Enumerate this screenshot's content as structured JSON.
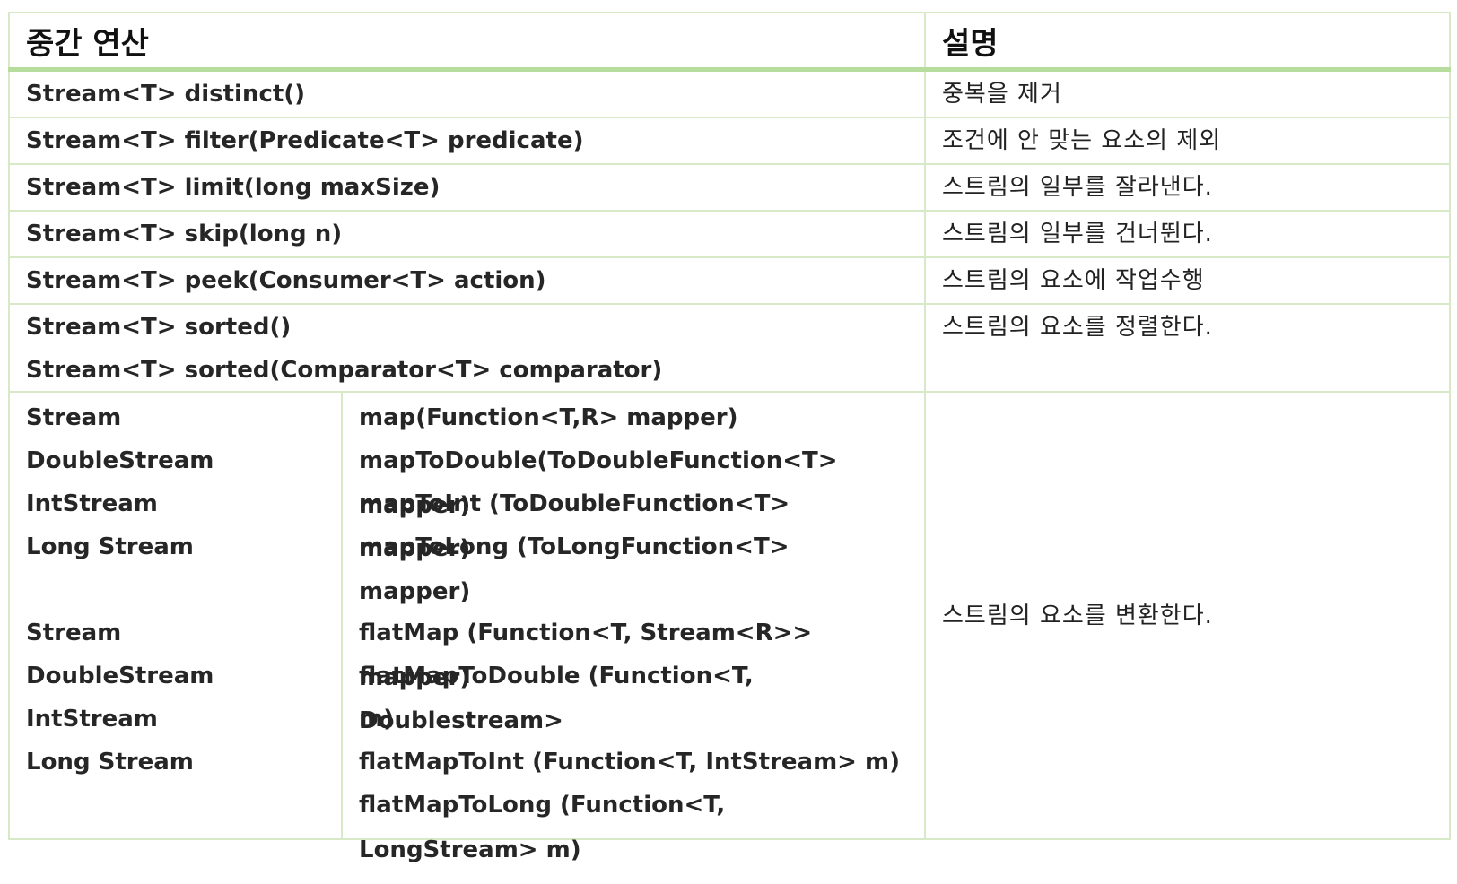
{
  "header": {
    "op": "중간 연산",
    "desc": "설명"
  },
  "rows": [
    {
      "op": "Stream<T> distinct()",
      "desc": "중복을 제거"
    },
    {
      "op": "Stream<T> filter(Predicate<T> predicate)",
      "desc": "조건에 안 맞는 요소의 제외"
    },
    {
      "op": "Stream<T> limit(long maxSize)",
      "desc": "스트림의 일부를 잘라낸다."
    },
    {
      "op": "Stream<T> skip(long n)",
      "desc": "스트림의 일부를 건너뛴다."
    },
    {
      "op": "Stream<T> peek(Consumer<T> action)",
      "desc": "스트림의 요소에 작업수행"
    }
  ],
  "sorted": {
    "ops": [
      "Stream<T> sorted()",
      "Stream<T> sorted(Comparator<T> comparator)"
    ],
    "desc": "스트림의 요소를 정렬한다."
  },
  "map": {
    "types": [
      "Stream",
      "DoubleStream",
      "IntStream",
      "Long Stream",
      "Stream",
      "DoubleStream",
      "IntStream",
      "Long Stream"
    ],
    "methods": [
      "map(Function<T,R> mapper)",
      "mapToDouble(ToDoubleFunction<T> mapper)",
      "mapToInt (ToDoubleFunction<T> mapper)",
      "mapToLong (ToLongFunction<T> mapper)",
      "flatMap (Function<T, Stream<R>> mapper)",
      "flatMapToDouble (Function<T, Doublestream>",
      "m)",
      "flatMapToInt (Function<T, IntStream> m)",
      "flatMapToLong (Function<T, LongStream> m)"
    ],
    "desc": "스트림의 요소를 변환한다."
  }
}
